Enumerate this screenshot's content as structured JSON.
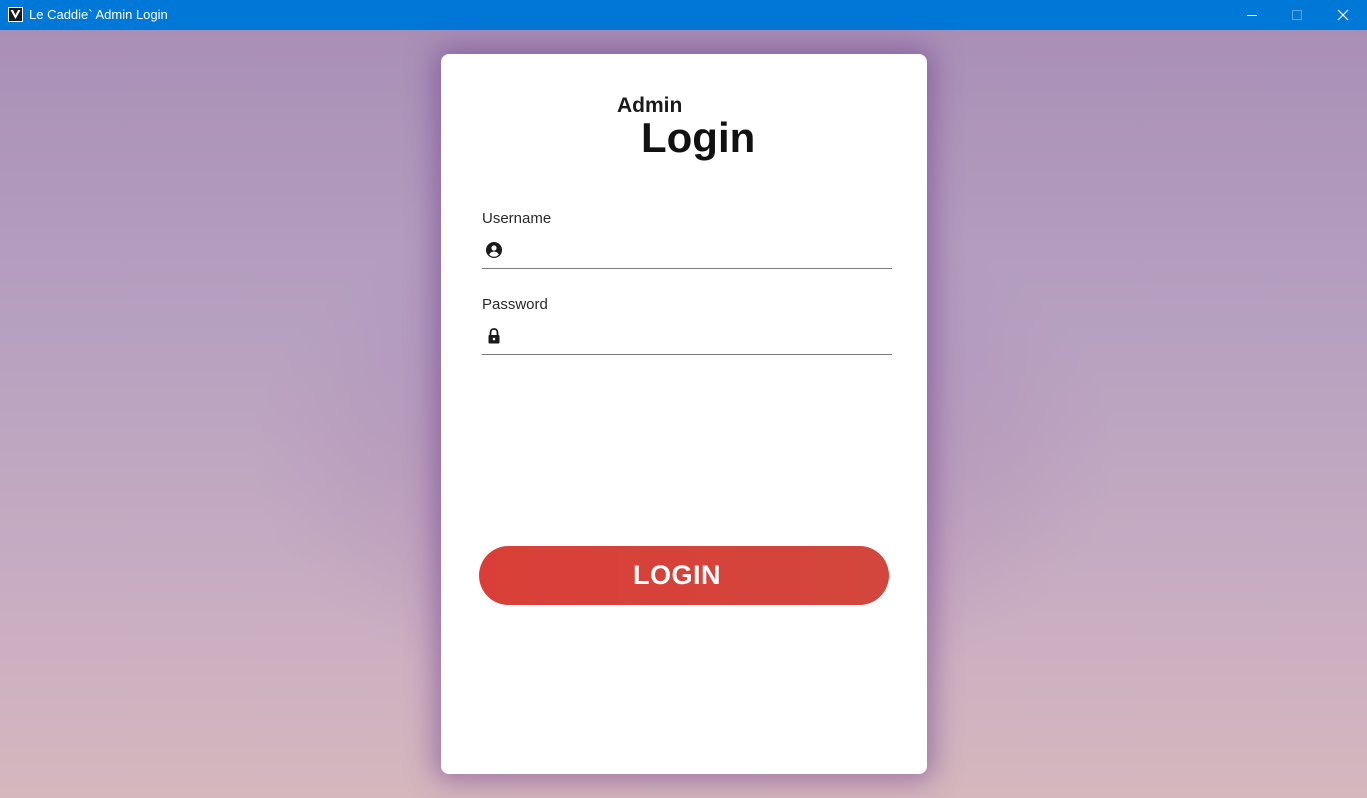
{
  "window": {
    "title": "Le Caddie` Admin Login",
    "app_icon": "caddie-logo-icon",
    "controls": [
      "minimize-icon",
      "maximize-icon",
      "close-icon"
    ]
  },
  "card": {
    "heading_small": "Admin",
    "heading_large": "Login",
    "username": {
      "label": "Username",
      "value": "",
      "placeholder": "",
      "icon": "user-circle-icon"
    },
    "password": {
      "label": "Password",
      "value": "",
      "placeholder": "",
      "icon": "lock-icon"
    },
    "login_button": "LOGIN"
  },
  "colors": {
    "titlebar": "#0078d7",
    "button": "#d8403a",
    "card": "#ffffff",
    "background_top": "#a98fb6",
    "background_bottom": "#d6b7bd"
  }
}
